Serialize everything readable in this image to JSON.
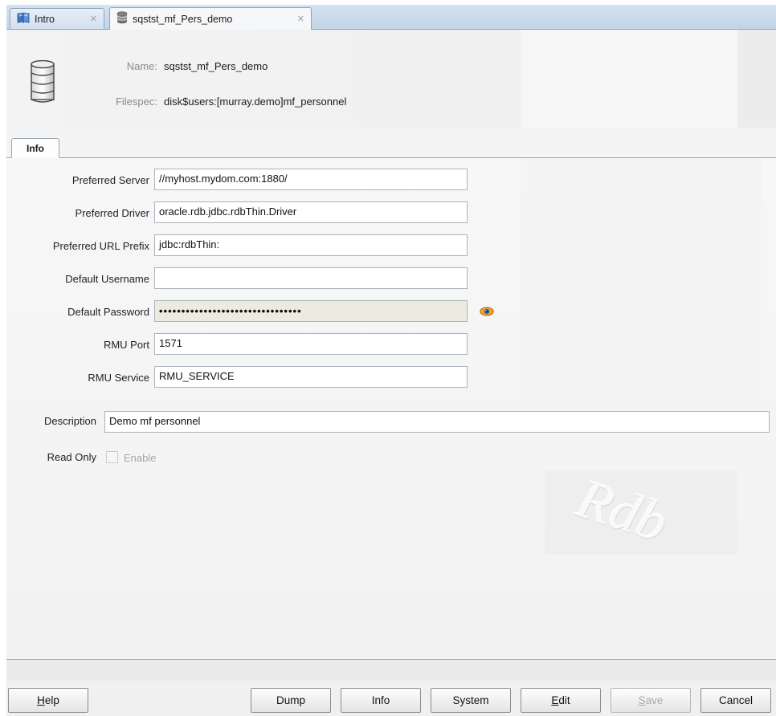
{
  "tabs": [
    {
      "label": "Intro",
      "icon": "book-icon",
      "active": false
    },
    {
      "label": "sqstst_mf_Pers_demo",
      "icon": "database-icon",
      "active": true
    }
  ],
  "header": {
    "name_label": "Name:",
    "name_value": "sqstst_mf_Pers_demo",
    "filespec_label": "Filespec:",
    "filespec_value": "disk$users:[murray.demo]mf_personnel"
  },
  "subtab": {
    "label": "Info"
  },
  "form": {
    "preferred_server": {
      "label": "Preferred Server",
      "value": "//myhost.mydom.com:1880/"
    },
    "preferred_driver": {
      "label": "Preferred Driver",
      "value": "oracle.rdb.jdbc.rdbThin.Driver"
    },
    "preferred_url_prefix": {
      "label": "Preferred URL Prefix",
      "value": "jdbc:rdbThin:"
    },
    "default_username": {
      "label": "Default Username",
      "value": ""
    },
    "default_password": {
      "label": "Default Password",
      "value": "••••••••••••••••••••••••••••••••"
    },
    "rmu_port": {
      "label": "RMU Port",
      "value": "1571"
    },
    "rmu_service": {
      "label": "RMU Service",
      "value": "RMU_SERVICE"
    },
    "description": {
      "label": "Description",
      "value": "Demo mf personnel"
    },
    "read_only": {
      "label": "Read Only",
      "checkbox_label": "Enable",
      "checked": false,
      "enabled": false
    }
  },
  "watermark": {
    "text": "Rdb"
  },
  "buttons": {
    "help_pre": "",
    "help_u": "H",
    "help_post": "elp",
    "dump": "Dump",
    "info": "Info",
    "system": "System",
    "edit_pre": "",
    "edit_u": "E",
    "edit_post": "dit",
    "save_pre": "",
    "save_u": "S",
    "save_post": "ave",
    "cancel": "Cancel"
  },
  "colors": {
    "accent": "#c2d4e8",
    "password_bg": "#ecebdf",
    "eye_icon": "#e07b00"
  }
}
